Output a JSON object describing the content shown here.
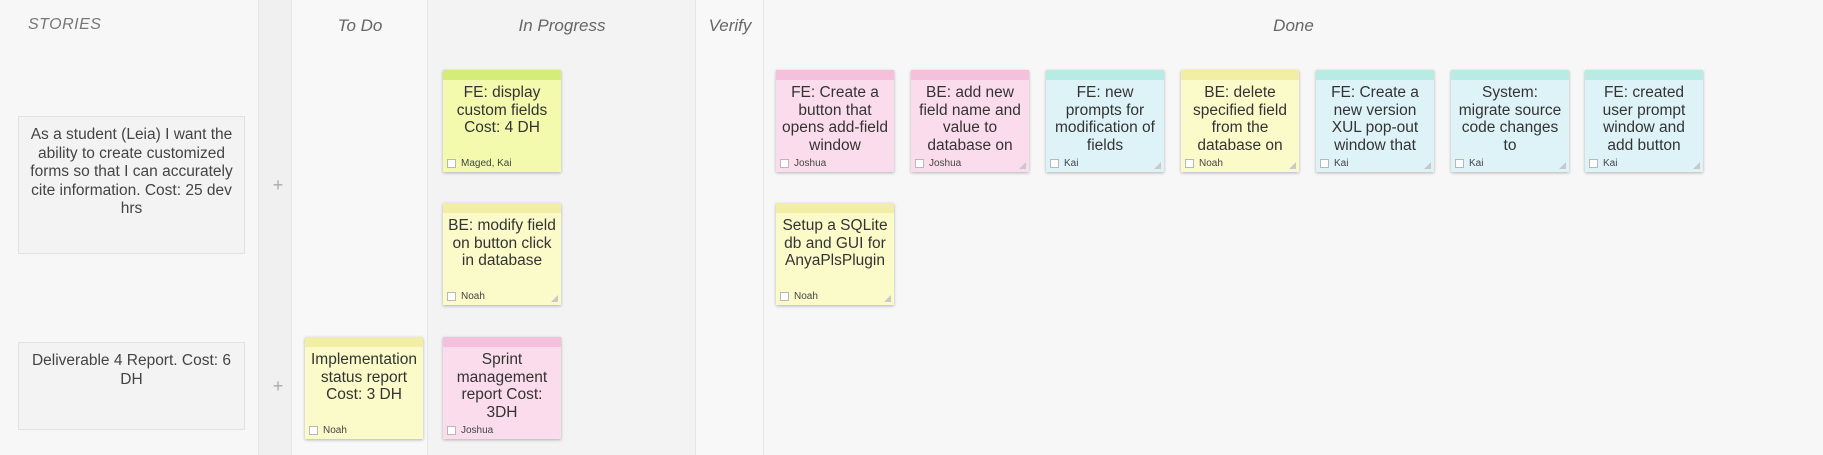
{
  "columns": {
    "stories": "STORIES",
    "todo": "To Do",
    "in_progress": "In Progress",
    "verify": "Verify",
    "done": "Done"
  },
  "stories": [
    {
      "text": "As a student (Leia) I want the ability to create customized forms so that I can accurately cite information. Cost: 25 dev hrs",
      "add": "+"
    },
    {
      "text": "Deliverable 4 Report. Cost: 6 DH",
      "add": "+"
    }
  ],
  "cards": {
    "inprog_1": {
      "text": "FE: display custom fields Cost: 4 DH",
      "owner": "Maged, Kai",
      "color": "#f3f9ad"
    },
    "inprog_2": {
      "text": "BE: modify field on button click in database",
      "owner": "Noah",
      "color": "#fbfac9"
    },
    "done_1": {
      "text": "FE: Create a button that opens add-field window",
      "owner": "Joshua",
      "color": "#fbdcec"
    },
    "done_2": {
      "text": "BE: add new field name and value to database on",
      "owner": "Joshua",
      "color": "#fbdcec"
    },
    "done_3": {
      "text": "FE: new prompts for modification of fields",
      "owner": "Kai",
      "color": "#def3f8"
    },
    "done_4": {
      "text": "BE: delete specified field from the database on",
      "owner": "Noah",
      "color": "#fbfac9"
    },
    "done_5": {
      "text": "FE: Create a new version XUL pop-out window that",
      "owner": "Kai",
      "color": "#def3f8"
    },
    "done_6": {
      "text": "System: migrate source code changes to",
      "owner": "Kai",
      "color": "#def3f8"
    },
    "done_7": {
      "text": "FE: created user prompt window and add button",
      "owner": "Kai",
      "color": "#def3f8"
    },
    "done_8": {
      "text": "Setup a SQLite db and GUI for AnyaPlsPlugin",
      "owner": "Noah",
      "color": "#fbfac9"
    },
    "todo_1": {
      "text": "Implementation status report Cost: 3 DH",
      "owner": "Noah",
      "color": "#fbfac9"
    },
    "inprog_3": {
      "text": "Sprint management report Cost: 3DH",
      "owner": "Joshua",
      "color": "#fbdcec"
    }
  }
}
